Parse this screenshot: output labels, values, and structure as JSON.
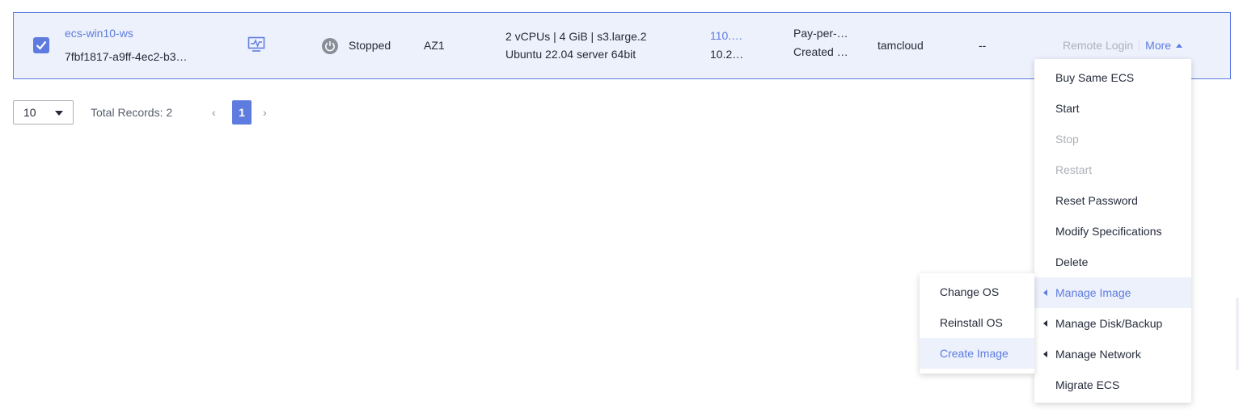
{
  "row": {
    "name": "ecs-win10-ws",
    "id": "7fbf1817-a9ff-4ec2-b3…",
    "status": "Stopped",
    "az": "AZ1",
    "spec_line1": "2 vCPUs | 4 GiB | s3.large.2",
    "spec_line2": "Ubuntu 22.04 server 64bit",
    "ip_line1": "110.…",
    "ip_line2": "10.2…",
    "billing_line1": "Pay-per-…",
    "billing_line2": "Created …",
    "project": "tamcloud",
    "tag": "--",
    "remote_login": "Remote Login",
    "more": "More"
  },
  "pagination": {
    "page_size": "10",
    "total": "Total Records: 2",
    "prev": "‹",
    "current": "1",
    "next": "›"
  },
  "more_menu": {
    "items": [
      {
        "label": "Buy Same ECS"
      },
      {
        "label": "Start"
      },
      {
        "label": "Stop"
      },
      {
        "label": "Restart"
      },
      {
        "label": "Reset Password"
      },
      {
        "label": "Modify Specifications"
      },
      {
        "label": "Delete"
      },
      {
        "label": "Manage Image"
      },
      {
        "label": "Manage Disk/Backup"
      },
      {
        "label": "Manage Network"
      },
      {
        "label": "Migrate ECS"
      }
    ]
  },
  "image_submenu": {
    "items": [
      {
        "label": "Change OS"
      },
      {
        "label": "Reinstall OS"
      },
      {
        "label": "Create Image"
      }
    ]
  },
  "colors": {
    "accent": "#5e7ce0",
    "row_selected_bg": "#edf1fc",
    "disabled_text": "#adb0b8"
  },
  "icons": [
    "checkbox-checked-icon",
    "monitor-icon",
    "power-icon",
    "chevron-up-icon",
    "chevron-left-icon",
    "chevron-right-icon",
    "dropdown-arrow-icon",
    "submenu-caret-icon"
  ]
}
